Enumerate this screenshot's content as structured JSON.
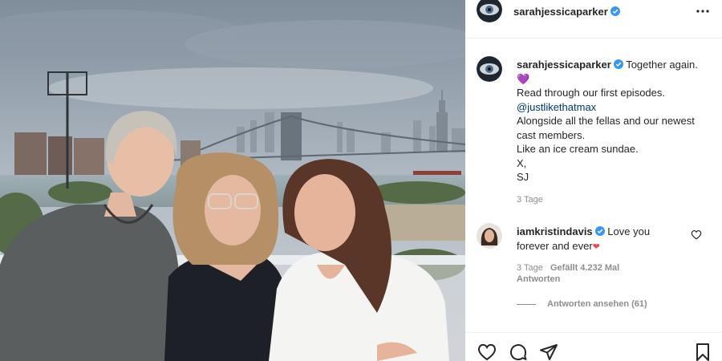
{
  "post": {
    "username": "sarahjessicaparker",
    "verified": true,
    "caption_lines": [
      "Together again.",
      "💜",
      "Read through our first episodes.",
      "@justlikethatmax",
      "Alongside all the fellas and our newest",
      "cast members.",
      "Like an ice cream sundae.",
      "X,",
      "SJ"
    ],
    "time": "3 Tage"
  },
  "comment": {
    "username": "iamkristindavis",
    "verified": true,
    "text": "Love you forever and ever",
    "heart": "❤",
    "time": "3 Tage",
    "likes": "Gefällt 4.232 Mal",
    "reply": "Antworten",
    "view_replies": "Antworten ansehen (61)"
  },
  "icons": {
    "verified": "verified-badge-icon",
    "more": "more-options-icon",
    "like": "heart-icon",
    "comment": "comment-icon",
    "share": "share-icon",
    "save": "bookmark-icon"
  },
  "colors": {
    "verified": "#3897f0",
    "mention": "#00376b",
    "muted": "#8e8e8e",
    "heart": "#ed4956"
  }
}
